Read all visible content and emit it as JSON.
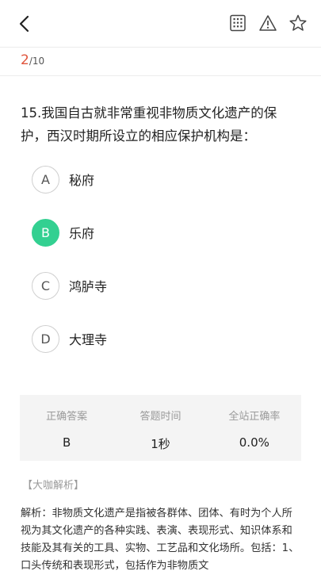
{
  "header": {
    "icons": [
      "back-arrow-icon",
      "answer-sheet-grid-icon",
      "report-warning-icon",
      "favorite-star-icon"
    ]
  },
  "progress": {
    "current": "2",
    "total": "/10"
  },
  "question": {
    "text": "15.我国自古就非常重视非物质文化遗产的保护，西汉时期所设立的相应保护机构是："
  },
  "options": [
    {
      "letter": "A",
      "text": "秘府",
      "selected": false
    },
    {
      "letter": "B",
      "text": "乐府",
      "selected": true
    },
    {
      "letter": "C",
      "text": "鸿胪寺",
      "selected": false
    },
    {
      "letter": "D",
      "text": "大理寺",
      "selected": false
    }
  ],
  "stats": {
    "correct_label": "正确答案",
    "correct_value": "B",
    "time_label": "答题时间",
    "time_value": "1秒",
    "rate_label": "全站正确率",
    "rate_value": "0.0%"
  },
  "analysis": {
    "title": "【大咖解析】",
    "text": "解析：非物质文化遗产是指被各群体、团体、有时为个人所视为其文化遗产的各种实践、表演、表现形式、知识体系和技能及其有关的工具、实物、工艺品和文化场所。包括：1、口头传统和表现形式，包括作为非物质文"
  },
  "colors": {
    "accent_red": "#e0553d",
    "selected_green": "#33d091",
    "stats_bg": "#f4f4f4"
  }
}
